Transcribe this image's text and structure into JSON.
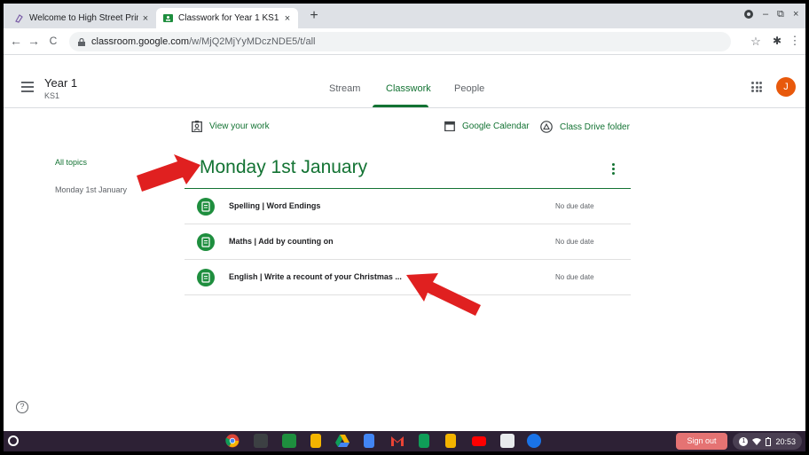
{
  "browser": {
    "tabs": [
      {
        "title": "Welcome to High Street Primary",
        "close": "×",
        "active": false
      },
      {
        "title": "Classwork for Year 1 KS1",
        "close": "×",
        "active": true
      }
    ],
    "new_tab": "+",
    "window_controls": [
      "–",
      "⧉",
      "×"
    ],
    "nav": {
      "back": "←",
      "forward": "→",
      "reload": "C"
    },
    "url_host": "classroom.google.com",
    "url_path": "/w/MjQ2MjYyMDczNDE5/t/all",
    "star": "☆",
    "extension": "✱",
    "menu": "⋮"
  },
  "classroom": {
    "class_name": "Year 1",
    "class_section": "KS1",
    "tabs": [
      {
        "label": "Stream",
        "selected": false
      },
      {
        "label": "Classwork",
        "selected": true
      },
      {
        "label": "People",
        "selected": false
      }
    ],
    "avatar_letter": "J",
    "accent": "#137333",
    "actions": {
      "view_work": "View your work",
      "calendar": "Google Calendar",
      "drive": "Class Drive folder"
    },
    "topic_nav": [
      "All topics",
      "Monday 1st January"
    ],
    "topic_title": "Monday 1st January",
    "assignments": [
      {
        "title": "Spelling | Word Endings",
        "due": "No due date"
      },
      {
        "title": "Maths | Add by counting on",
        "due": "No due date"
      },
      {
        "title": "English | Write a recount of your Christmas ...",
        "due": "No due date"
      }
    ],
    "help": "?"
  },
  "shelf": {
    "sign_out": "Sign out",
    "notification_count": "1",
    "time": "20:53",
    "apps": [
      "chrome-icon",
      "calculator-icon",
      "classroom-icon",
      "slides-icon",
      "drive-icon",
      "docs-icon",
      "gmail-icon",
      "sheets-icon",
      "keep-icon",
      "youtube-icon",
      "camera-icon",
      "files-icon"
    ]
  }
}
